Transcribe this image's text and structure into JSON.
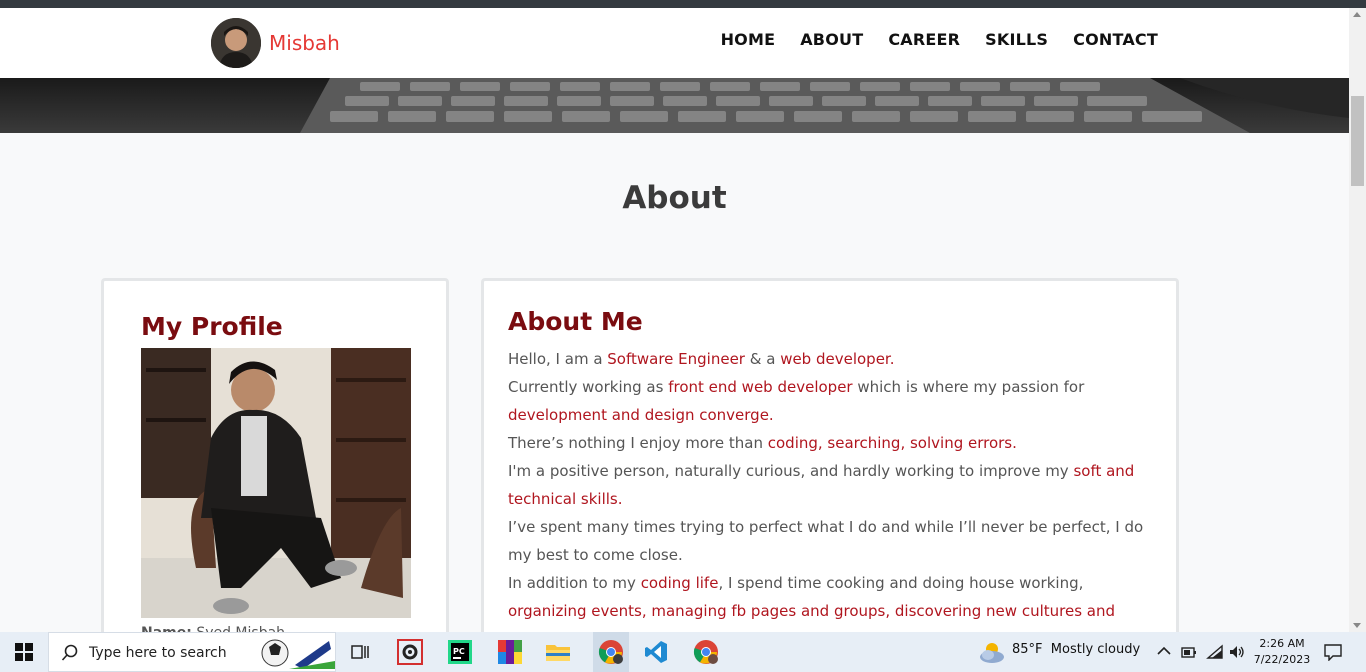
{
  "navbar": {
    "brand_name": "Misbah",
    "links": [
      "HOME",
      "ABOUT",
      "CAREER",
      "SKILLS",
      "CONTACT"
    ]
  },
  "section_title": "About",
  "profile": {
    "heading": "My Profile",
    "name_label": "Name:",
    "name_value": "Syed Misbah"
  },
  "about": {
    "heading": "About Me",
    "lines": [
      [
        {
          "t": "Hello, I am a "
        },
        {
          "t": "Software Engineer",
          "h": true
        },
        {
          "t": " & a "
        },
        {
          "t": "web developer.",
          "h": true
        }
      ],
      [
        {
          "t": "Currently working as "
        },
        {
          "t": "front end web developer",
          "h": true
        },
        {
          "t": " which is where my passion for"
        }
      ],
      [
        {
          "t": "development and design converge.",
          "h": true
        }
      ],
      [
        {
          "t": "There’s nothing I enjoy more than "
        },
        {
          "t": "coding, searching, solving errors.",
          "h": true
        }
      ],
      [
        {
          "t": "I'm a positive person, naturally curious, and hardly working to improve my "
        },
        {
          "t": "soft and",
          "h": true
        }
      ],
      [
        {
          "t": "technical skills.",
          "h": true
        }
      ],
      [
        {
          "t": "I’ve spent many times trying to perfect what I do and while I’ll never be perfect, I do"
        }
      ],
      [
        {
          "t": "my best to come close."
        }
      ],
      [
        {
          "t": "In addition to my "
        },
        {
          "t": "coding life",
          "h": true
        },
        {
          "t": ", I spend time cooking and doing house working,"
        }
      ],
      [
        {
          "t": "organizing events, managing fb pages and groups, discovering new cultures and",
          "h": true
        }
      ]
    ]
  },
  "taskbar": {
    "search_placeholder": "Type here to search",
    "weather_temp": "85°F",
    "weather_text": "Mostly cloudy",
    "time": "2:26 AM",
    "date": "7/22/2023"
  },
  "colors": {
    "brand": "#e53935",
    "heading": "#7a0c10",
    "highlight": "#b0161f"
  }
}
